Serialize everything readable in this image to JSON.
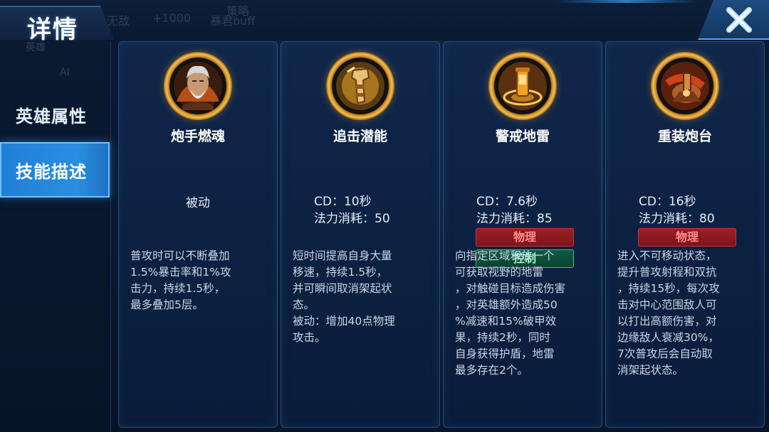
{
  "header": {
    "title": "详情",
    "background_labels": [
      "无敌",
      "+1000",
      "策略",
      "暴君buff"
    ]
  },
  "sidebar": {
    "background_labels": [
      "英雄",
      "AI"
    ],
    "items": [
      {
        "label": "英雄属性",
        "active": false
      },
      {
        "label": "技能描述",
        "active": true
      }
    ]
  },
  "skills": [
    {
      "name": "炮手燃魂",
      "type": "被动",
      "icon": "gunner-portrait-icon",
      "description": "普攻时可以不断叠加\n1.5%暴击率和1%攻\n击力，持续1.5秒，\n最多叠加5层。"
    },
    {
      "name": "追击潜能",
      "cd": "CD：10秒",
      "mana": "法力消耗：50",
      "icon": "mechanical-arm-icon",
      "description": "短时间提高自身大量\n移速，持续1.5秒，\n并可瞬间取消架起状\n态。\n被动：增加40点物理\n攻击。"
    },
    {
      "name": "警戒地雷",
      "cd": "CD：7.6秒",
      "mana": "法力消耗：85",
      "tags": {
        "physical": "物理",
        "control": "控制"
      },
      "icon": "landmine-icon",
      "description": "向指定区域释放一个\n可获取视野的地雷\n，对触碰目标造成伤害\n，对英雄额外造成50\n%减速和15%破甲效\n果，持续2秒，同时\n自身获得护盾，地雷\n最多存在2个。"
    },
    {
      "name": "重装炮台",
      "cd": "CD：16秒",
      "mana": "法力消耗：80",
      "tags": {
        "physical": "物理"
      },
      "icon": "heavy-turret-icon",
      "description": "进入不可移动状态，\n提升普攻射程和双抗\n，持续15秒，每次攻\n击对中心范围敌人可\n以打出高额伤害，对\n边缘敌人衰减30%，\n7次普攻后会自动取\n消架起状态。"
    }
  ],
  "colors": {
    "accent": "#2a8ee0",
    "physical_tag": "#9c1f24",
    "control_tag": "#0f5a3e",
    "card_border": "#2b4d78"
  }
}
